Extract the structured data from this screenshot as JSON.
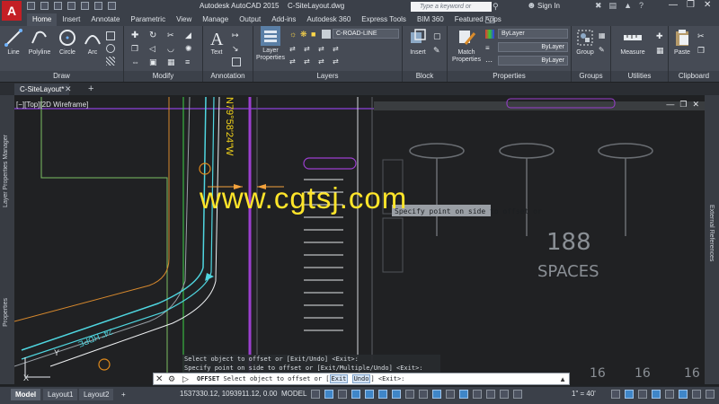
{
  "titlebar": {
    "app_letter": "A",
    "app_name": "Autodesk AutoCAD 2015",
    "file_name": "C-SiteLayout.dwg",
    "search_placeholder": "Type a keyword or phrase",
    "signin": "Sign In"
  },
  "ribbon_tabs": [
    "Home",
    "Insert",
    "Annotate",
    "Parametric",
    "View",
    "Manage",
    "Output",
    "Add-ins",
    "Autodesk 360",
    "Express Tools",
    "BIM 360",
    "Featured Apps"
  ],
  "ribbon": {
    "draw": {
      "title": "Draw",
      "line": "Line",
      "polyline": "Polyline",
      "circle": "Circle",
      "arc": "Arc"
    },
    "modify": {
      "title": "Modify"
    },
    "annotation": {
      "title": "Annotation",
      "text": "Text"
    },
    "layers": {
      "title": "Layers",
      "layer_properties": "Layer Properties",
      "current_layer": "C-ROAD-LINE"
    },
    "block": {
      "title": "Block",
      "insert": "Insert"
    },
    "properties": {
      "title": "Properties",
      "match": "Match Properties",
      "color": "ByLayer",
      "linetype": "ByLayer",
      "lineweight": "ByLayer"
    },
    "groups": {
      "title": "Groups",
      "group": "Group"
    },
    "utilities": {
      "title": "Utilities",
      "measure": "Measure"
    },
    "clipboard": {
      "title": "Clipboard",
      "paste": "Paste"
    }
  },
  "document_tab": "C-SiteLayout*",
  "viewport_label": "[−][Top][2D Wireframe]",
  "palettes": {
    "left_top": "Layer Properties Manager",
    "left_bottom": "Properties",
    "right": "External References"
  },
  "drawing_text": {
    "bearing": "N79°58'24\"W",
    "pipe": "24\" HDPE",
    "spaces_count": "188",
    "spaces_label": "SPACES",
    "stall_numbers": [
      "16",
      "16",
      "16"
    ],
    "grip_label": "Specify point on side to offset or"
  },
  "watermark": "www.cgtsj.com",
  "command_history": [
    "Select object to offset or [Exit/Undo] <Exit>:",
    "Specify point on side to offset or [Exit/Multiple/Undo] <Exit>:"
  ],
  "command_line": {
    "command": "OFFSET",
    "prompt_start": " Select object to offset or [",
    "opt_exit": "Exit",
    "opt_undo": "Undo",
    "prompt_end": "] <Exit>:"
  },
  "statusbar": {
    "layouts": [
      "Model",
      "Layout1",
      "Layout2"
    ],
    "coords": "1537330.12, 1093911.12, 0.00",
    "space": "MODEL",
    "scale": "1\" = 40'"
  },
  "colors": {
    "ribbon": "#464b55",
    "canvas": "#202123",
    "accent_blue": "#3f86c8",
    "watermark": "#ffe52a"
  }
}
